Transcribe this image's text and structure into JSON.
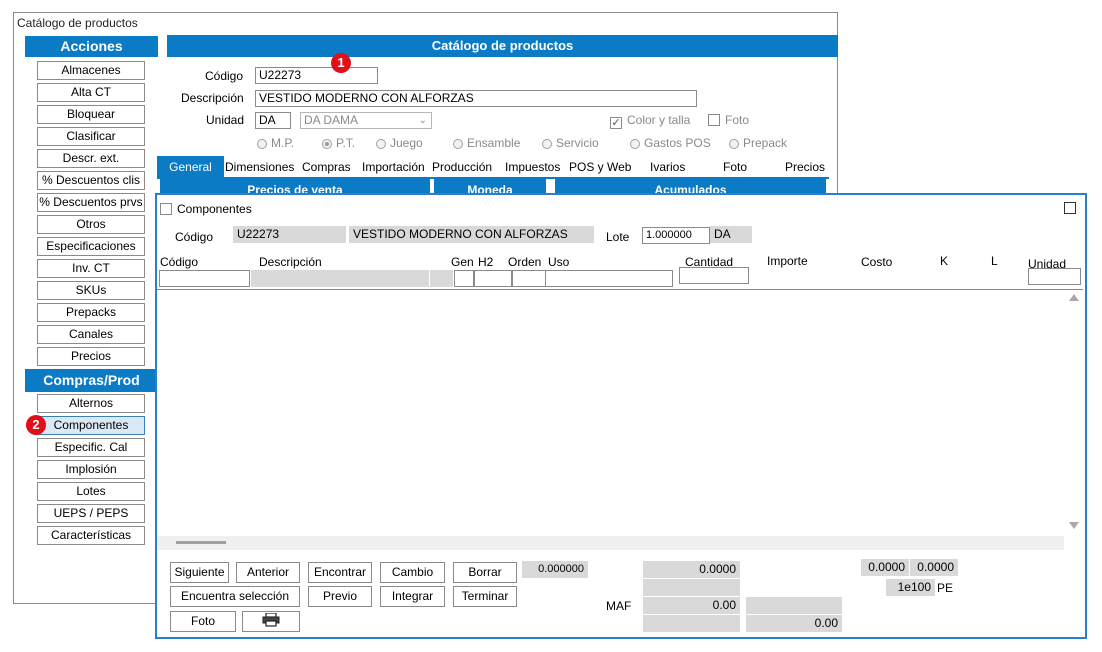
{
  "window": {
    "title": "Catálogo de productos"
  },
  "sidebar": {
    "acciones_header": "Acciones",
    "acciones": [
      "Almacenes",
      "Alta CT",
      "Bloquear",
      "Clasificar",
      "Descr. ext.",
      "% Descuentos clis",
      "% Descuentos prvs",
      "Otros",
      "Especificaciones",
      "Inv. CT",
      "SKUs",
      "Prepacks",
      "Canales",
      "Precios"
    ],
    "compras_header": "Compras/Prod",
    "compras": [
      "Alternos",
      "Componentes",
      "Especific. Cal",
      "Implosión",
      "Lotes",
      "UEPS / PEPS",
      "Características"
    ]
  },
  "main": {
    "header": "Catálogo de productos",
    "codigo_label": "Código",
    "codigo_value": "U22273",
    "descripcion_label": "Descripción",
    "descripcion_value": "VESTIDO MODERNO CON ALFORZAS",
    "unidad_label": "Unidad",
    "unidad_value": "DA",
    "unidad_select": "DA  DAMA",
    "color_talla_label": "Color y talla",
    "foto_label": "Foto",
    "radios": [
      "M.P.",
      "P.T.",
      "Juego",
      "Ensamble",
      "Servicio",
      "Gastos POS",
      "Prepack"
    ],
    "tabs": [
      "General",
      "Dimensiones",
      "Compras",
      "Importación",
      "Producción",
      "Impuestos",
      "POS y Web",
      "Ivarios",
      "Foto",
      "Precios"
    ],
    "subheaders": [
      "Precios de venta",
      "Moneda",
      "Acumulados"
    ]
  },
  "badges": {
    "one": "1",
    "two": "2"
  },
  "dialog": {
    "title": "Componentes",
    "codigo_label": "Código",
    "codigo_value": "U22273",
    "descripcion_value": "VESTIDO MODERNO CON ALFORZAS",
    "lote_label": "Lote",
    "lote_value": "1.000000",
    "lote_unit": "DA",
    "columns": {
      "codigo": "Código",
      "descripcion": "Descripción",
      "gen": "Gen",
      "h2": "H2",
      "orden": "Orden",
      "uso": "Uso",
      "cantidad": "Cantidad",
      "importe": "Importe",
      "costo": "Costo",
      "k": "K",
      "l": "L",
      "unidad": "Unidad"
    },
    "buttons": {
      "siguiente": "Siguiente",
      "anterior": "Anterior",
      "encontrar": "Encontrar",
      "cambio": "Cambio",
      "borrar": "Borrar",
      "encuentra_seleccion": "Encuentra selección",
      "previo": "Previo",
      "integrar": "Integrar",
      "terminar": "Terminar",
      "foto": "Foto",
      "print_icon": "printer-icon"
    },
    "footer": {
      "value1": "0.000000",
      "importe_total": "0.0000",
      "maf_label": "MAF",
      "maf_value": "0.00",
      "bottom_value": "0.00",
      "k_value": "0.0000",
      "l_value": "0.0000",
      "exp_value": "1e100",
      "exp_unit": "PE"
    }
  }
}
